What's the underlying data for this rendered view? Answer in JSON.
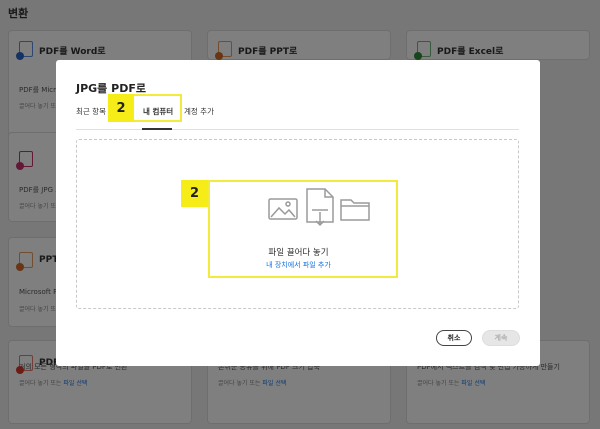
{
  "page": {
    "title": "변환"
  },
  "cards": [
    {
      "title": "PDF를 Word로",
      "desc": "PDF를 Micro",
      "sub": "끌어다 놓기 또",
      "link": "",
      "color": "#2b66c5"
    },
    {
      "title": "PDF를 PPT로",
      "desc": "",
      "sub": "",
      "link": "",
      "color": "#d06a2a"
    },
    {
      "title": "PDF를 Excel로",
      "desc": "",
      "sub": "",
      "link": "",
      "color": "#2f8a3c"
    },
    {
      "title": "",
      "desc": "PDF를 JPG 또",
      "sub": "끌어다 놓기 또",
      "link": "",
      "color": "#c9306f"
    },
    {
      "title": "PPT",
      "desc": "Microsoft Po",
      "sub": "끌어다 놓기 또",
      "link": "",
      "color": "#d06a2a"
    },
    {
      "title": "PDF",
      "desc": "거의 모든 형식의 파일을 PDF로 변환",
      "sub": "끌어다 놓기 또는",
      "link": "파일 선택",
      "color": "#d9382b"
    },
    {
      "title": "",
      "desc": "손쉬운 공유를 위해 PDF 크기 압축",
      "sub": "끌어다 놓기 또는",
      "link": "파일 선택",
      "color": "#d9382b"
    },
    {
      "title": "",
      "desc": "PDF에서 텍스트를 검색 및 편집 가능하게 만들기",
      "sub": "끌어다 놓기 또는",
      "link": "파일 선택",
      "color": "#d9382b"
    }
  ],
  "modal": {
    "title": "JPG를 PDF로",
    "tabs": [
      {
        "label": "최근 항목",
        "active": false
      },
      {
        "label": "내 컴퓨터",
        "active": true
      },
      {
        "label": "계정 추가",
        "active": false
      }
    ],
    "dropzone": {
      "label": "파일 끌어다 놓기",
      "link": "내 장치에서 파일 추가"
    },
    "buttons": {
      "cancel": "취소",
      "continue": "계속"
    }
  },
  "callouts": [
    {
      "number": "2"
    },
    {
      "number": "2"
    }
  ],
  "colors": {
    "accent": "#1473e6",
    "callout": "#f5ec18"
  }
}
